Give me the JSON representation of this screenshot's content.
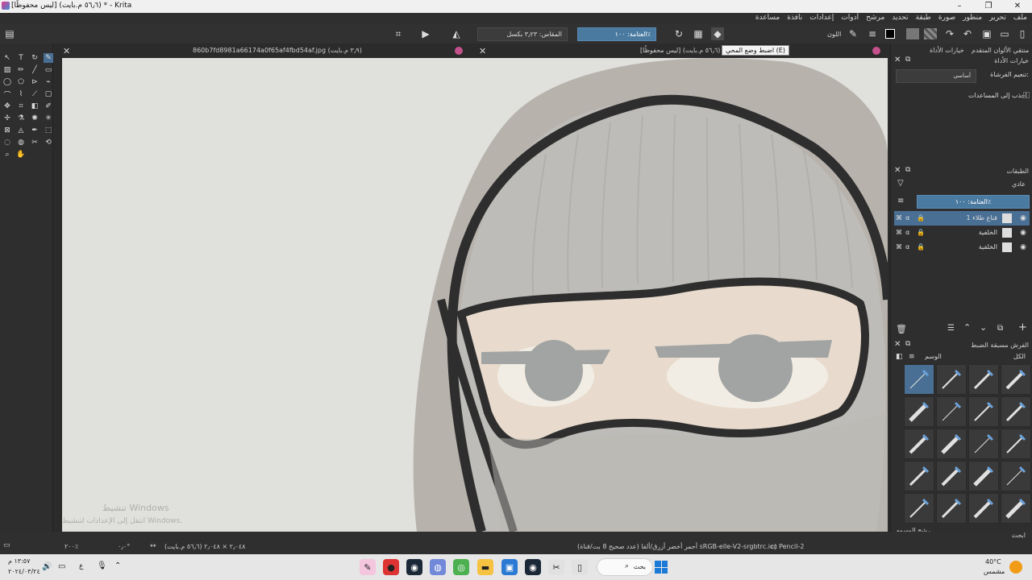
{
  "window": {
    "title": "[ليس محفوظًا] (٥٦٫٦ م.بايت) * - Krita"
  },
  "menu": [
    "ملف",
    "تحرير",
    "منظور",
    "صورة",
    "طبقة",
    "تحديد",
    "مرشح",
    "أدوات",
    "إعدادات",
    "نافذة",
    "مساعدة"
  ],
  "toolbar": {
    "color_label": "اللون",
    "opacity_field": "العتامة: ١٠٠٪",
    "size_field": "المقاس: ٣٫٢٣ بكسل",
    "tooltip": "اضبط وضع المحي (E)"
  },
  "tabs": [
    {
      "label": "860b7fd8981a66174a0f65af4fbd54af.jpg (٣٫٩ م.بايت)"
    },
    {
      "label": "[ليس محفوظًا] (٥٦٫٦ م.بايت) *"
    }
  ],
  "dock": {
    "tab_tool_options": "خيارات الأداة",
    "tab_color_selector": "منتقي الألوان المتقدم",
    "tool_options_title": "خيارات الأداة",
    "smoothing_label": "تنعيم الفرشاة:",
    "smoothing_value": "أساسي",
    "snap_label": "اجذب إلى المساعدات",
    "layers_title": "الطبقات",
    "blend_mode": "عادي",
    "layer_opacity": "العتامة: ١٠٠٪",
    "layers": [
      {
        "name": "قناع طلاء 1",
        "selected": true
      },
      {
        "name": "الخلفية",
        "selected": false
      },
      {
        "name": "الخلفية",
        "selected": false
      }
    ],
    "presets_title": "الفرش مسبقة الضبط",
    "tag_label": "الوسم",
    "all_label": "الكل",
    "filter_label": "رشح الوسوم",
    "search_label": "ابحث"
  },
  "status": {
    "brush": "c) Pencil-2",
    "color_profile": "أحمر أخضر أزرق/ألفا (عدد صحيح 8 بت/قناة)  sRGB-elle-V2-srgbtrc.icc",
    "dimensions": "٢٫٠٤٨ × ٢٫٠٤٨ (٥٦٫٦ م.بايت)",
    "rotation": "٠٫٠°",
    "zoom": "٢٠٠٪"
  },
  "watermark": {
    "line1": "تنشيط Windows",
    "line2": "انتقل إلى الإعدادات لتنشيط Windows."
  },
  "taskbar": {
    "search_label": "بحث",
    "time": "١٣:٥٧ م",
    "date": "٢٠٢٤/٠٣/٢٤",
    "weather_temp": "40°C",
    "weather_text": "مشمس"
  }
}
